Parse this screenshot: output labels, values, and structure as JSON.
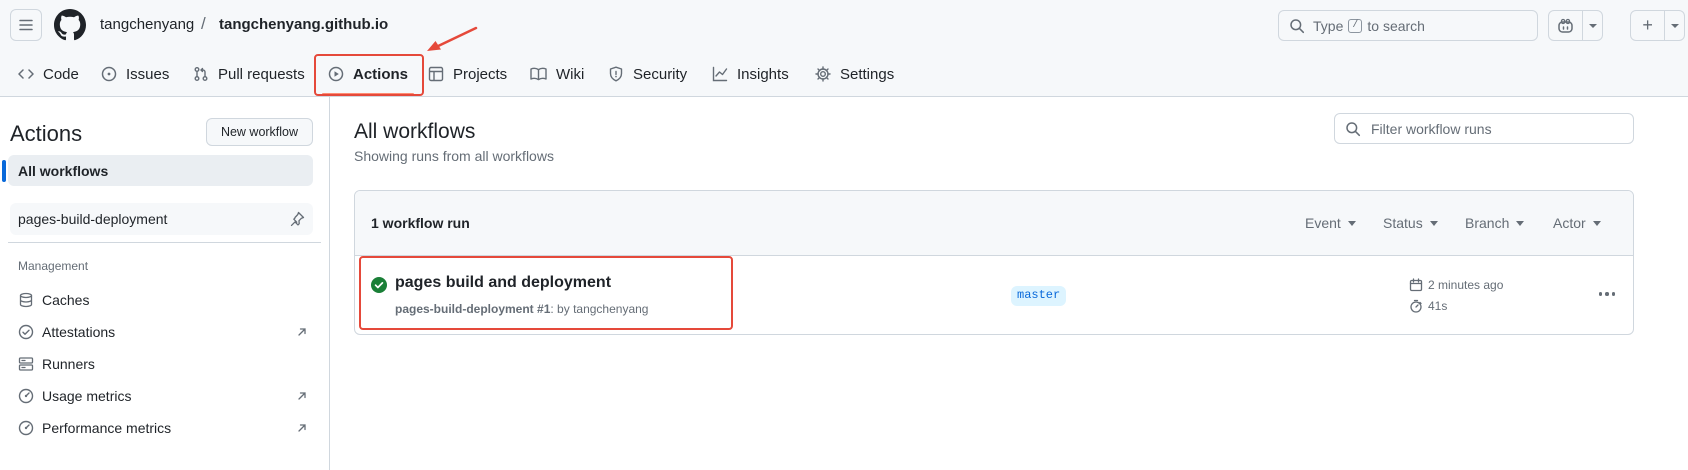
{
  "header": {
    "owner": "tangchenyang",
    "separator": "/",
    "repo": "tangchenyang.github.io",
    "search": {
      "prefix": "Type",
      "key": "/",
      "suffix": "to search"
    },
    "new_label": "+"
  },
  "repo_nav": {
    "tabs": [
      {
        "label": "Code",
        "icon": "code-icon"
      },
      {
        "label": "Issues",
        "icon": "issue-opened-icon"
      },
      {
        "label": "Pull requests",
        "icon": "git-pull-request-icon"
      },
      {
        "label": "Actions",
        "icon": "play-icon",
        "selected": true
      },
      {
        "label": "Projects",
        "icon": "table-icon"
      },
      {
        "label": "Wiki",
        "icon": "book-icon"
      },
      {
        "label": "Security",
        "icon": "shield-icon"
      },
      {
        "label": "Insights",
        "icon": "graph-icon"
      },
      {
        "label": "Settings",
        "icon": "gear-icon"
      }
    ]
  },
  "sidebar": {
    "title": "Actions",
    "new_workflow_label": "New workflow",
    "all_workflows_label": "All workflows",
    "workflows": [
      {
        "label": "pages-build-deployment",
        "pinned": true
      }
    ],
    "section_label": "Management",
    "management": [
      {
        "label": "Caches",
        "icon": "cache-icon",
        "external": false
      },
      {
        "label": "Attestations",
        "icon": "check-circle-icon",
        "external": true
      },
      {
        "label": "Runners",
        "icon": "server-icon",
        "external": false
      },
      {
        "label": "Usage metrics",
        "icon": "meter-icon",
        "external": true
      },
      {
        "label": "Performance metrics",
        "icon": "meter-icon",
        "external": true
      }
    ]
  },
  "main": {
    "title": "All workflows",
    "subtitle": "Showing runs from all workflows",
    "filter_placeholder": "Filter workflow runs",
    "runs_header": {
      "count_label": "1 workflow run",
      "filters": [
        "Event",
        "Status",
        "Branch",
        "Actor"
      ]
    },
    "runs": [
      {
        "status": "success",
        "title": "pages build and deployment",
        "workflow": "pages-build-deployment",
        "run_number": "#1",
        "actor_text": ": by tangchenyang",
        "branch": "master",
        "when": "2 minutes ago",
        "duration": "41s"
      }
    ]
  },
  "colors": {
    "accent": "#0969da",
    "success": "#1a7f37",
    "nav_underline": "#fd8c73",
    "annotation": "#e5493a",
    "border": "#d0d7de"
  }
}
